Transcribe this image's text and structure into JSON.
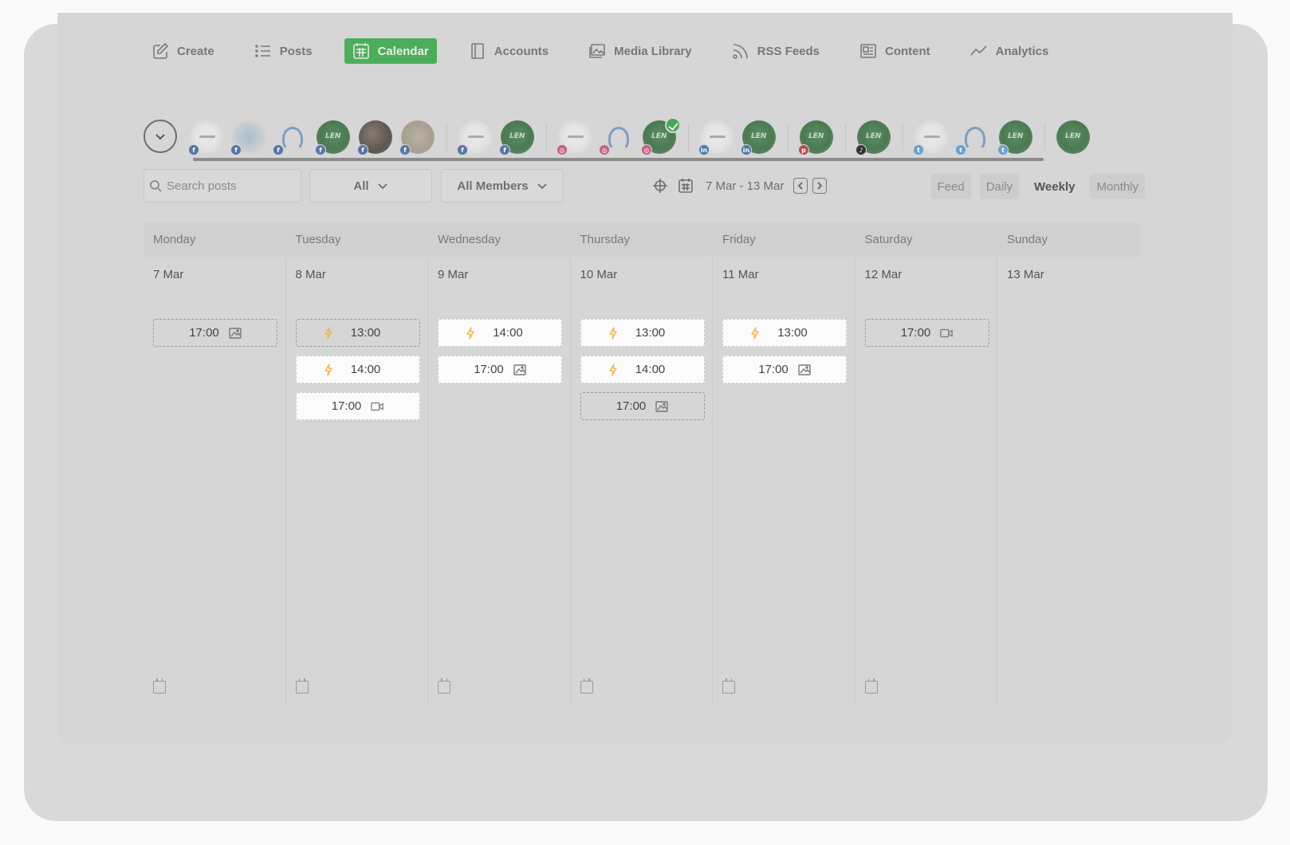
{
  "nav": [
    {
      "label": "Create",
      "icon": "edit-icon"
    },
    {
      "label": "Posts",
      "icon": "list-icon"
    },
    {
      "label": "Calendar",
      "icon": "calendar-icon",
      "active": true
    },
    {
      "label": "Accounts",
      "icon": "notebook-icon"
    },
    {
      "label": "Media Library",
      "icon": "images-icon"
    },
    {
      "label": "RSS Feeds",
      "icon": "rss-icon"
    },
    {
      "label": "Content",
      "icon": "newspaper-icon"
    },
    {
      "label": "Analytics",
      "icon": "trend-icon"
    }
  ],
  "accounts": [
    {
      "avatar": "logo",
      "network": "fb"
    },
    {
      "avatar": "art",
      "network": "fb"
    },
    {
      "avatar": "bird",
      "network": "fb"
    },
    {
      "avatar": "green",
      "network": "fb"
    },
    {
      "avatar": "dark",
      "network": "fb"
    },
    {
      "avatar": "map",
      "network": "fb"
    },
    {
      "divider": true
    },
    {
      "avatar": "logo",
      "network": "fb"
    },
    {
      "avatar": "green",
      "network": "fb"
    },
    {
      "divider": true
    },
    {
      "avatar": "logo",
      "network": "ig"
    },
    {
      "avatar": "bird",
      "network": "ig"
    },
    {
      "avatar": "green",
      "network": "ig",
      "selected": true
    },
    {
      "divider": true
    },
    {
      "avatar": "logo",
      "network": "li"
    },
    {
      "avatar": "green",
      "network": "li"
    },
    {
      "divider": true
    },
    {
      "avatar": "green",
      "network": "pin"
    },
    {
      "divider": true
    },
    {
      "avatar": "green",
      "network": "tt"
    },
    {
      "divider": true
    },
    {
      "avatar": "logo",
      "network": "tw"
    },
    {
      "avatar": "bird",
      "network": "tw"
    },
    {
      "avatar": "green",
      "network": "tw"
    },
    {
      "divider": true
    },
    {
      "avatar": "green",
      "network": "none"
    }
  ],
  "filters": {
    "search_placeholder": "Search posts",
    "type_value": "All",
    "members_value": "All Members"
  },
  "date_range": "7 Mar - 13 Mar",
  "views": [
    {
      "label": "Feed"
    },
    {
      "label": "Daily"
    },
    {
      "label": "Weekly",
      "active": true
    },
    {
      "label": "Monthly"
    }
  ],
  "days": [
    {
      "name": "Monday",
      "date": "7 Mar",
      "events": [
        {
          "time": "17:00",
          "state": "past",
          "bolt": false,
          "media": "image"
        }
      ]
    },
    {
      "name": "Tuesday",
      "date": "8 Mar",
      "events": [
        {
          "time": "13:00",
          "state": "past",
          "bolt": true,
          "media": ""
        },
        {
          "time": "14:00",
          "state": "future",
          "bolt": true,
          "media": ""
        },
        {
          "time": "17:00",
          "state": "future",
          "bolt": false,
          "media": "video"
        }
      ]
    },
    {
      "name": "Wednesday",
      "date": "9 Mar",
      "events": [
        {
          "time": "14:00",
          "state": "future",
          "bolt": true,
          "media": ""
        },
        {
          "time": "17:00",
          "state": "future",
          "bolt": false,
          "media": "image"
        }
      ]
    },
    {
      "name": "Thursday",
      "date": "10 Mar",
      "events": [
        {
          "time": "13:00",
          "state": "future",
          "bolt": true,
          "media": ""
        },
        {
          "time": "14:00",
          "state": "future",
          "bolt": true,
          "media": ""
        },
        {
          "time": "17:00",
          "state": "past",
          "bolt": false,
          "media": "image"
        }
      ]
    },
    {
      "name": "Friday",
      "date": "11 Mar",
      "events": [
        {
          "time": "13:00",
          "state": "future",
          "bolt": true,
          "media": ""
        },
        {
          "time": "17:00",
          "state": "future",
          "bolt": false,
          "media": "image"
        }
      ]
    },
    {
      "name": "Saturday",
      "date": "12 Mar",
      "events": [
        {
          "time": "17:00",
          "state": "past",
          "bolt": false,
          "media": "video"
        }
      ]
    },
    {
      "name": "Sunday",
      "date": "13 Mar",
      "events": []
    }
  ],
  "colors": {
    "accent": "#4cae5a",
    "bolt": "#f0b45a"
  }
}
